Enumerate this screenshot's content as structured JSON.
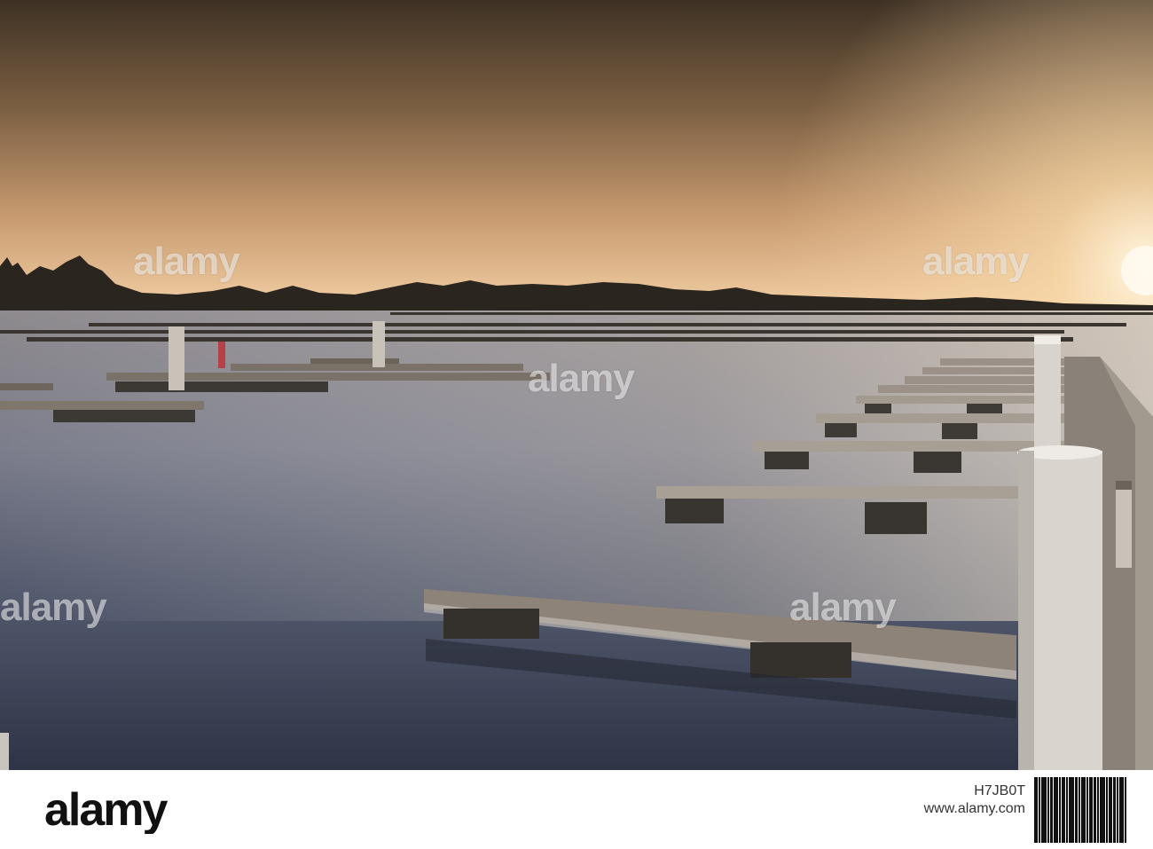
{
  "photo": {
    "subject": "marina-sunset",
    "colors": {
      "sky_top": "#4a3a2c",
      "sky_mid": "#9a7a55",
      "sky_horizon": "#f2c79a",
      "sun": "#fff4dc",
      "water_light": "#b8b8c4",
      "water_dark": "#3c4252",
      "pontoon": "#7a6f63",
      "post": "#d9d6d0"
    }
  },
  "watermark": {
    "text": "alamy"
  },
  "footer": {
    "logo_text": "alamy",
    "image_id": "H7JB0T",
    "site": "www.alamy.com"
  }
}
